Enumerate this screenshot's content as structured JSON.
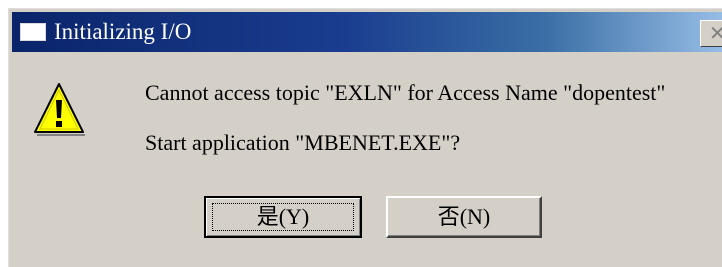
{
  "window": {
    "title": "Initializing I/O",
    "close_glyph": "✕"
  },
  "message": {
    "icon": "warning-icon",
    "line1": "Cannot access topic \"EXLN\" for Access Name \"dopentest\"",
    "line2": "Start application \"MBENET.EXE\"?"
  },
  "buttons": {
    "yes_label": "是(Y)",
    "no_label": "否(N)"
  },
  "colors": {
    "titlebar_start": "#0a246a",
    "titlebar_end": "#a6caf0",
    "dialog_bg": "#d4d0c8",
    "warning_yellow": "#ffff00"
  }
}
